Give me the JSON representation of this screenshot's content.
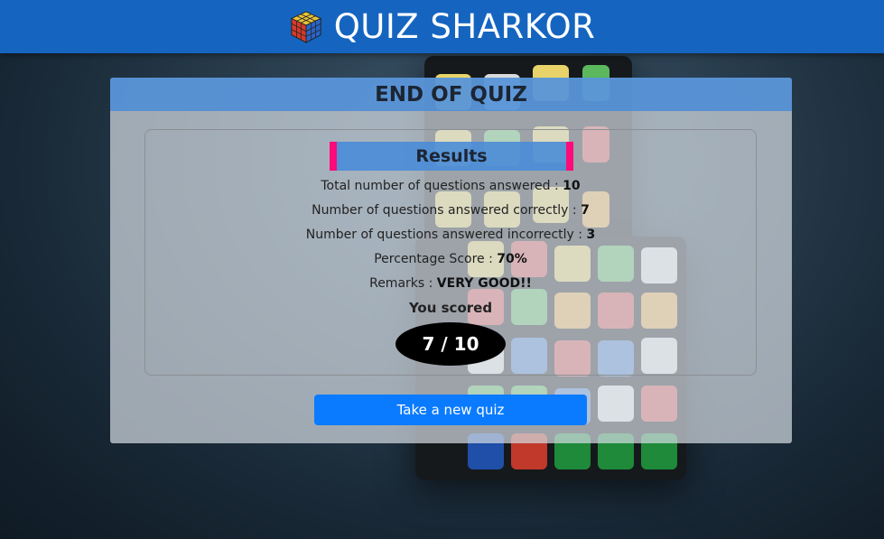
{
  "header": {
    "app_title": "QUIZ SHARKOR",
    "logo_icon": "rubiks-cube-icon"
  },
  "card": {
    "title": "END OF QUIZ",
    "results_heading": "Results",
    "stats": [
      {
        "label": "Total number of questions answered : ",
        "value": "10"
      },
      {
        "label": "Number of questions answered correctly : ",
        "value": "7"
      },
      {
        "label": "Number of questions answered incorrectly : ",
        "value": "3"
      },
      {
        "label": "Percentage Score : ",
        "value": "70%"
      },
      {
        "label": "Remarks : ",
        "value": "VERY GOOD!!"
      }
    ],
    "you_scored_label": "You scored",
    "score_display": "7 / 10"
  },
  "actions": {
    "new_quiz_label": "Take a new quiz"
  },
  "colors": {
    "header_bg": "#1565c0",
    "accent_pink": "#ff0a78",
    "button_blue": "#0a7bff"
  }
}
